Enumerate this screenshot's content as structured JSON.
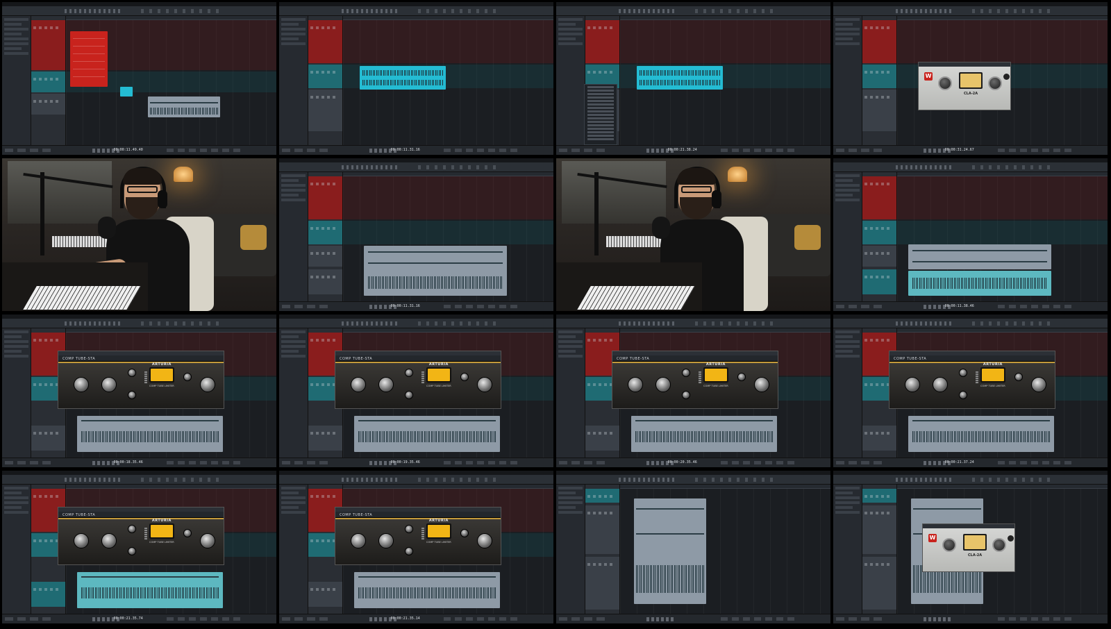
{
  "frames": [
    {
      "time": "00:00:11.49.40"
    },
    {
      "time": "00:00:11.31.16"
    },
    {
      "time": "00:00:21.38.24"
    },
    {
      "time": "00:00:31.24.67"
    },
    {
      "time": ""
    },
    {
      "time": "00:00:11.31.16"
    },
    {
      "time": ""
    },
    {
      "time": "00:00:11.38.46"
    },
    {
      "time": "00:00:18.35.46"
    },
    {
      "time": "00:00:19.35.46"
    },
    {
      "time": "00:00:20.35.46"
    },
    {
      "time": "00:00:21.37.24"
    },
    {
      "time": "00:00:21.35.74"
    },
    {
      "time": "00:00:21.35.14"
    },
    {
      "time": ""
    },
    {
      "time": ""
    }
  ],
  "plugins": {
    "la2a_name": "CLA-2A",
    "la2a_logo": "W",
    "arturia_brand": "ARTURIA",
    "arturia_model": "COMP TUBE-STA",
    "arturia_switch": "COMP   TUBE   LIMITER"
  },
  "colors": {
    "red_track": "#c8231d",
    "cyan_event": "#24bcd3",
    "teal_event": "#5db8c0",
    "grey_event": "#8e9aa6",
    "vu_amber": "#f2b515"
  }
}
